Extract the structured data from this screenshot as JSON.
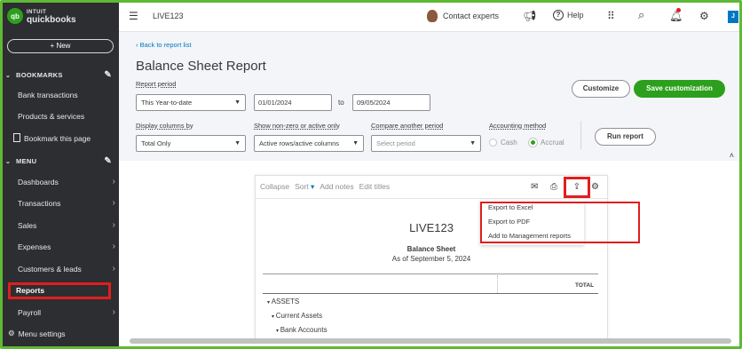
{
  "brand": {
    "intuit": "INTUIT",
    "name": "quickbooks",
    "logo_letters": "qb"
  },
  "sidebar": {
    "new_label": "+ New",
    "bookmarks_title": "BOOKMARKS",
    "bookmarks": [
      {
        "label": "Bank transactions"
      },
      {
        "label": "Products & services"
      },
      {
        "label": "Bookmark this page"
      }
    ],
    "menu_title": "MENU",
    "menu": [
      {
        "label": "Dashboards"
      },
      {
        "label": "Transactions"
      },
      {
        "label": "Sales"
      },
      {
        "label": "Expenses"
      },
      {
        "label": "Customers & leads"
      },
      {
        "label": "Reports"
      },
      {
        "label": "Payroll"
      }
    ],
    "menu_settings": "Menu settings"
  },
  "topbar": {
    "company": "LIVE123",
    "contact": "Contact experts",
    "help": "Help",
    "user_initial": "J"
  },
  "header": {
    "back_link": "Back to report list",
    "title": "Balance Sheet Report",
    "report_period_label": "Report period",
    "report_period_value": "This Year-to-date",
    "date_from": "01/01/2024",
    "to_label": "to",
    "date_to": "09/05/2024",
    "customize": "Customize",
    "save_customization": "Save customization",
    "display_columns_label": "Display columns by",
    "display_columns_value": "Total Only",
    "show_nonzero_label": "Show non-zero or active only",
    "show_nonzero_value": "Active rows/active columns",
    "compare_label": "Compare another period",
    "compare_placeholder": "Select period",
    "accounting_label": "Accounting method",
    "cash": "Cash",
    "accrual": "Accrual",
    "run_report": "Run report"
  },
  "report": {
    "toolbar": {
      "collapse": "Collapse",
      "sort": "Sort",
      "add_notes": "Add notes",
      "edit_titles": "Edit titles"
    },
    "export_menu": [
      "Export to Excel",
      "Export to PDF",
      "Add to Management reports"
    ],
    "company": "LIVE123",
    "name": "Balance Sheet",
    "as_of": "As of September 5, 2024",
    "total_header": "TOTAL",
    "rows": [
      "ASSETS",
      "Current Assets",
      "Bank Accounts"
    ]
  },
  "colors": {
    "sidebar": "#2d2e31",
    "accent_green": "#2ca01c",
    "link_blue": "#0077c5",
    "highlight_red": "#e01e1e"
  }
}
